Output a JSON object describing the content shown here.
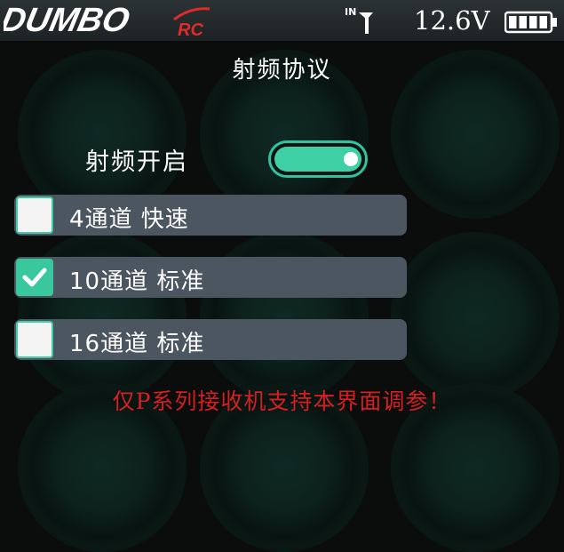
{
  "status_bar": {
    "brand": "DUMBO",
    "brand_suffix": "RC",
    "signal_label": "IN",
    "voltage": "12.6V",
    "battery_level": 1.0
  },
  "page": {
    "title": "射频协议"
  },
  "rf": {
    "label": "射频开启",
    "enabled": true
  },
  "protocols": [
    {
      "label": "4通道 快速",
      "checked": false
    },
    {
      "label": "10通道 标准",
      "checked": true
    },
    {
      "label": "16通道 标准",
      "checked": false
    }
  ],
  "footer": {
    "notice": "仅P系列接收机支持本界面调参！"
  },
  "colors": {
    "accent": "#3fcfa5",
    "warning": "#d42020",
    "row_bg": "#4c5660"
  }
}
